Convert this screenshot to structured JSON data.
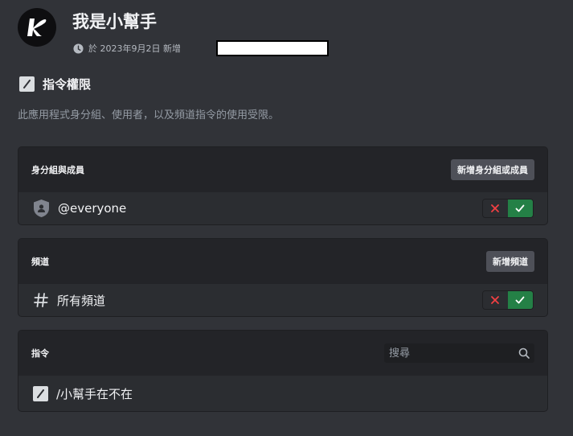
{
  "app": {
    "name": "我是小幫手",
    "added_text": "於 2023年9月2日 新增"
  },
  "permissions": {
    "title": "指令權限",
    "description": "此應用程式身分組、使用者，以及頻道指令的使用受限。"
  },
  "roles_card": {
    "header": "身分組與成員",
    "add_button": "新增身分組或成員",
    "rows": [
      {
        "label": "@everyone"
      }
    ]
  },
  "channels_card": {
    "header": "頻道",
    "add_button": "新增頻道",
    "rows": [
      {
        "label": "所有頻道"
      }
    ]
  },
  "commands_card": {
    "header": "指令",
    "search_placeholder": "搜尋",
    "rows": [
      {
        "label": "/小幫手在不在"
      }
    ]
  },
  "colors": {
    "background": "#313338",
    "card_header": "#232428",
    "allow_green": "#248046",
    "deny_red": "#f23f43"
  }
}
